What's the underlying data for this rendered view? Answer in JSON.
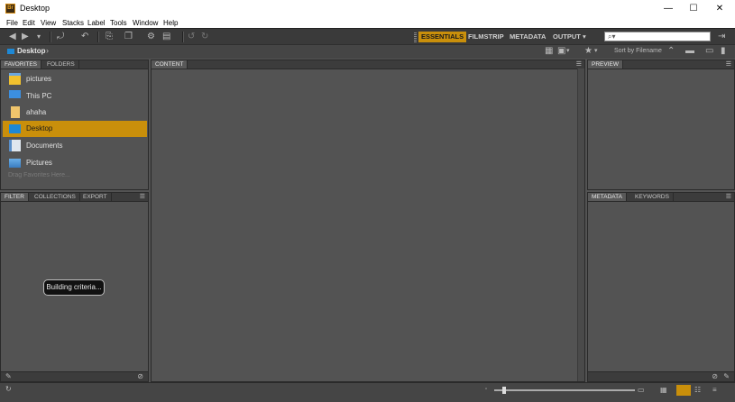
{
  "window": {
    "app_icon": "Br",
    "title": "Desktop",
    "controls": {
      "minimize": "—",
      "maximize": "☐",
      "close": "✕"
    }
  },
  "menu": [
    "File",
    "Edit",
    "View",
    "Stacks",
    "Label",
    "Tools",
    "Window",
    "Help"
  ],
  "toolbar": {
    "workspaces": [
      "ESSENTIALS",
      "FILMSTRIP",
      "METADATA",
      "OUTPUT"
    ],
    "workspace_dropdown": "▾",
    "search": {
      "placeholder": "⌕▾",
      "value": ""
    },
    "sort_label": "Sort by Filename",
    "icons": [
      "back-arrow-icon",
      "forward-arrow-icon",
      "recent-dropdown-icon",
      "boomerang-icon",
      "rotate-icon",
      "camera-icon",
      "copy-icon",
      "refine-icon",
      "open-icon",
      "rotate-left-icon",
      "rotate-right-icon",
      "view-icon",
      "star-filter-icon",
      "new-folder-icon",
      "delete-icon"
    ]
  },
  "path": {
    "label": "Desktop",
    "chevron": "›"
  },
  "left_top_panel": {
    "tabs": [
      "FAVORITES",
      "FOLDERS"
    ],
    "favorites": [
      {
        "label": "pictures",
        "icon": "library-icon"
      },
      {
        "label": "This PC",
        "icon": "computer-icon"
      },
      {
        "label": "ahaha",
        "icon": "user-folder-icon"
      },
      {
        "label": "Desktop",
        "icon": "desktop-icon",
        "selected": true
      },
      {
        "label": "Documents",
        "icon": "documents-icon"
      },
      {
        "label": "Pictures",
        "icon": "pictures-icon"
      }
    ],
    "drop_hint": "Drag Favorites Here..."
  },
  "left_bottom_panel": {
    "tabs": [
      "FILTER",
      "COLLECTIONS",
      "EXPORT"
    ],
    "toast": "Building criteria..."
  },
  "center_panel": {
    "tabs": [
      "CONTENT"
    ]
  },
  "right_top_panel": {
    "tabs": [
      "PREVIEW"
    ]
  },
  "right_bottom_panel": {
    "tabs": [
      "METADATA",
      "KEYWORDS"
    ]
  },
  "colors": {
    "accent": "#c98f0b",
    "panel": "#535353",
    "toolbar": "#3a3a3a"
  }
}
